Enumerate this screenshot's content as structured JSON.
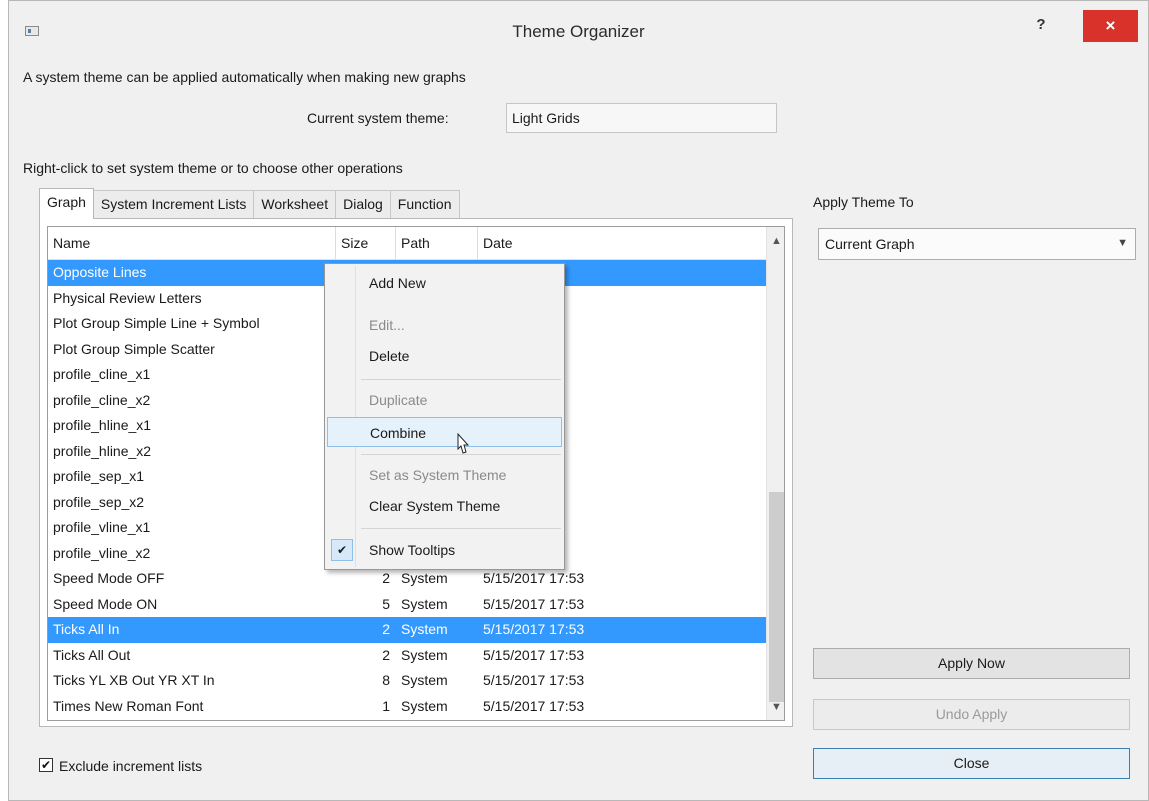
{
  "window": {
    "title": "Theme Organizer",
    "help_label": "?",
    "close_label": "×"
  },
  "intro_text": "A system theme can be applied automatically when making new graphs",
  "current_theme": {
    "label": "Current system theme:",
    "value": "Light Grids"
  },
  "hint_text": "Right-click to set system theme or to choose other operations",
  "tabs": [
    {
      "label": "Graph",
      "active": true
    },
    {
      "label": "System Increment Lists",
      "active": false
    },
    {
      "label": "Worksheet",
      "active": false
    },
    {
      "label": "Dialog",
      "active": false
    },
    {
      "label": "Function",
      "active": false
    }
  ],
  "table": {
    "columns": [
      "Name",
      "Size",
      "Path",
      "Date"
    ],
    "rows": [
      {
        "name": "Opposite Lines",
        "size": "",
        "path": "",
        "date": "17:53",
        "selected": true
      },
      {
        "name": "Physical Review Letters",
        "size": "",
        "path": "",
        "date": "17:53"
      },
      {
        "name": "Plot Group Simple Line + Symbol",
        "size": "",
        "path": "",
        "date": "17:53"
      },
      {
        "name": "Plot Group Simple Scatter",
        "size": "",
        "path": "",
        "date": "17:53"
      },
      {
        "name": "profile_cline_x1",
        "size": "",
        "path": "",
        "date": "17:53"
      },
      {
        "name": "profile_cline_x2",
        "size": "",
        "path": "",
        "date": "17:53"
      },
      {
        "name": "profile_hline_x1",
        "size": "",
        "path": "",
        "date": "17:53"
      },
      {
        "name": "profile_hline_x2",
        "size": "",
        "path": "",
        "date": "17:53"
      },
      {
        "name": "profile_sep_x1",
        "size": "",
        "path": "",
        "date": "17:53"
      },
      {
        "name": "profile_sep_x2",
        "size": "",
        "path": "",
        "date": "17:53"
      },
      {
        "name": "profile_vline_x1",
        "size": "",
        "path": "",
        "date": "17:53"
      },
      {
        "name": "profile_vline_x2",
        "size": "",
        "path": "",
        "date": "17:53"
      },
      {
        "name": "Speed Mode OFF",
        "size": "2",
        "path": "System",
        "date": "5/15/2017 17:53"
      },
      {
        "name": "Speed Mode ON",
        "size": "5",
        "path": "System",
        "date": "5/15/2017 17:53"
      },
      {
        "name": "Ticks All In",
        "size": "2",
        "path": "System",
        "date": "5/15/2017 17:53",
        "selected": true
      },
      {
        "name": "Ticks All Out",
        "size": "2",
        "path": "System",
        "date": "5/15/2017 17:53"
      },
      {
        "name": "Ticks YL XB Out YR XT In",
        "size": "8",
        "path": "System",
        "date": "5/15/2017 17:53"
      },
      {
        "name": "Times New Roman Font",
        "size": "1",
        "path": "System",
        "date": "5/15/2017 17:53"
      }
    ]
  },
  "context_menu": {
    "items": [
      {
        "label": "Add New",
        "enabled": true
      },
      {
        "label": "Edit...",
        "enabled": false
      },
      {
        "label": "Delete",
        "enabled": true
      },
      {
        "label": "Duplicate",
        "enabled": false
      },
      {
        "label": "Combine",
        "enabled": true,
        "hovered": true
      },
      {
        "label": "Set as System Theme",
        "enabled": false
      },
      {
        "label": "Clear System Theme",
        "enabled": true
      },
      {
        "label": "Show Tooltips",
        "enabled": true,
        "checked": true
      }
    ]
  },
  "apply_theme_to": {
    "label": "Apply Theme To",
    "selected": "Current Graph"
  },
  "buttons": {
    "apply_now": "Apply Now",
    "undo_apply": "Undo Apply",
    "close": "Close"
  },
  "exclude_increment_lists": {
    "label": "Exclude increment lists",
    "checked": true
  },
  "colors": {
    "selection": "#3399ff",
    "close_button": "#d9322a"
  },
  "icons": {
    "app": "window-app-icon",
    "check": "check-icon",
    "dropdown": "chevron-down-icon",
    "cursor": "mouse-pointer-icon"
  }
}
